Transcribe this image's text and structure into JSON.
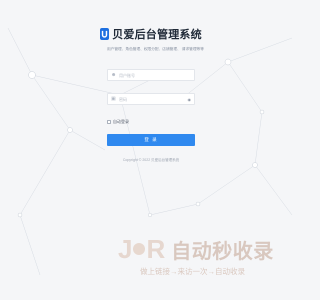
{
  "app": {
    "title": "贝爱后台管理系统",
    "logo_icon": "shield-u-logo-icon",
    "subtitle": "用户管理、角色管理、权限分配、店铺管理、 请求管理等等"
  },
  "form": {
    "username_placeholder": "用户账号",
    "password_placeholder": "密码",
    "remember_label": "自动登录",
    "remember_checked": false,
    "login_label": "登 录"
  },
  "footer": {
    "copyright": "Copyright © 2022 贝爱后台管理系统"
  },
  "watermark": {
    "letters": [
      "J",
      "R"
    ],
    "title": "自动秒收录",
    "slogan": "做上链接→来访一次→自动收录"
  },
  "colors": {
    "accent": "#2f89ef",
    "background": "#f5f6f8",
    "watermark": "#e6d7cf"
  }
}
